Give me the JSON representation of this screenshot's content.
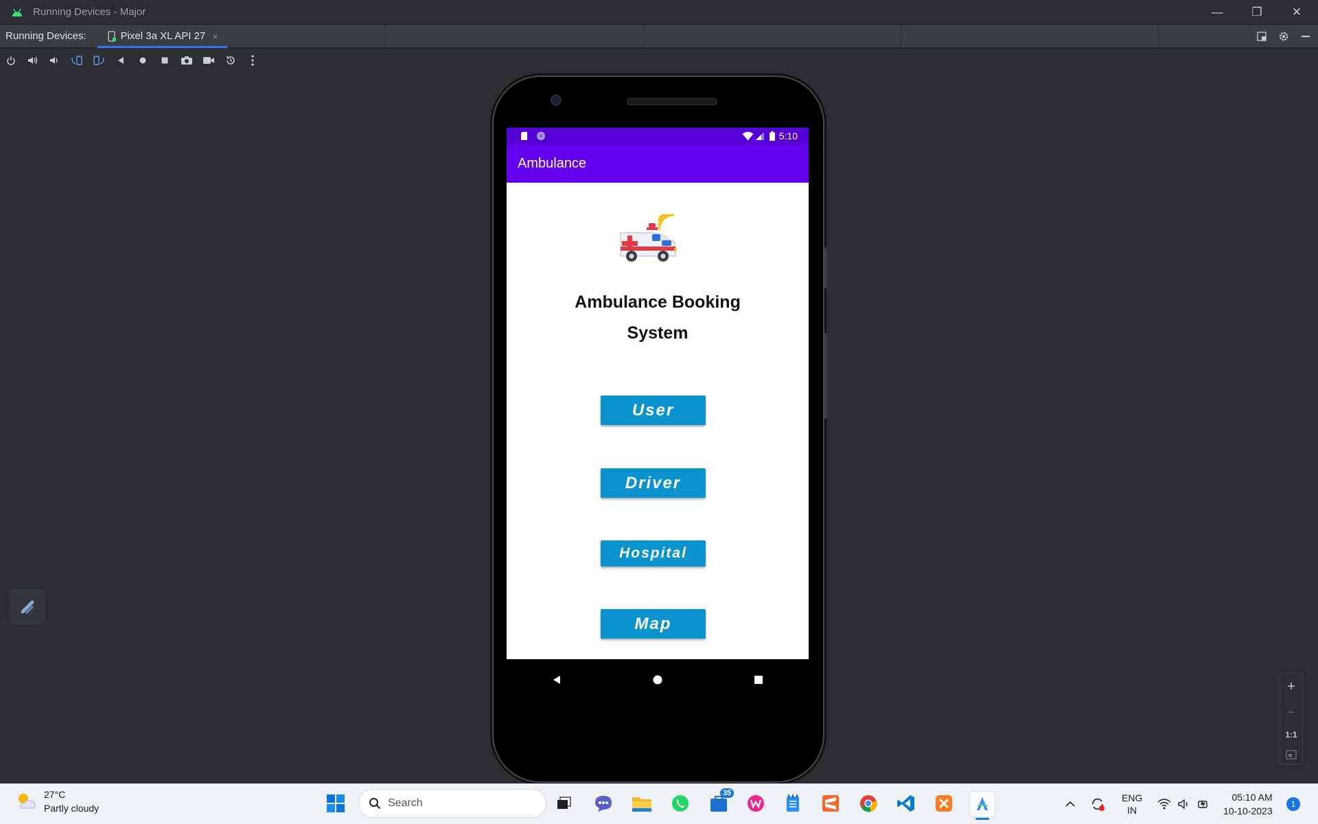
{
  "window": {
    "title": "Running Devices - Major",
    "minimize": "—",
    "restore": "❐",
    "close": "✕"
  },
  "tabbar": {
    "label": "Running Devices:",
    "active_tab": "Pixel 3a XL API 27",
    "close_glyph": "×"
  },
  "device_toolbar": {
    "icons": [
      "power-icon",
      "volume-up-icon",
      "volume-down-icon",
      "rotate-left-icon",
      "rotate-right-icon",
      "back-icon",
      "home-icon",
      "overview-icon",
      "screenshot-icon",
      "screen-record-icon",
      "reset-icon",
      "more-icon"
    ]
  },
  "phone": {
    "status_time": "5:10",
    "app_title": "Ambulance",
    "headline_line1": "Ambulance Booking",
    "headline_line2": "System",
    "buttons": [
      "User",
      "Driver",
      "Hospital",
      "Map"
    ],
    "colors": {
      "status_bar": "#5300d5",
      "app_bar": "#6200ee",
      "button": "#0b93ce"
    }
  },
  "zoom": {
    "plus": "+",
    "minus": "−",
    "one_to_one": "1:1"
  },
  "taskbar": {
    "temperature": "27°C",
    "weather": "Partly cloudy",
    "search_placeholder": "Search",
    "store_badge": "35",
    "lang_line1": "ENG",
    "lang_line2": "IN",
    "time": "05:10 AM",
    "date": "10-10-2023",
    "notification_count": "1"
  }
}
